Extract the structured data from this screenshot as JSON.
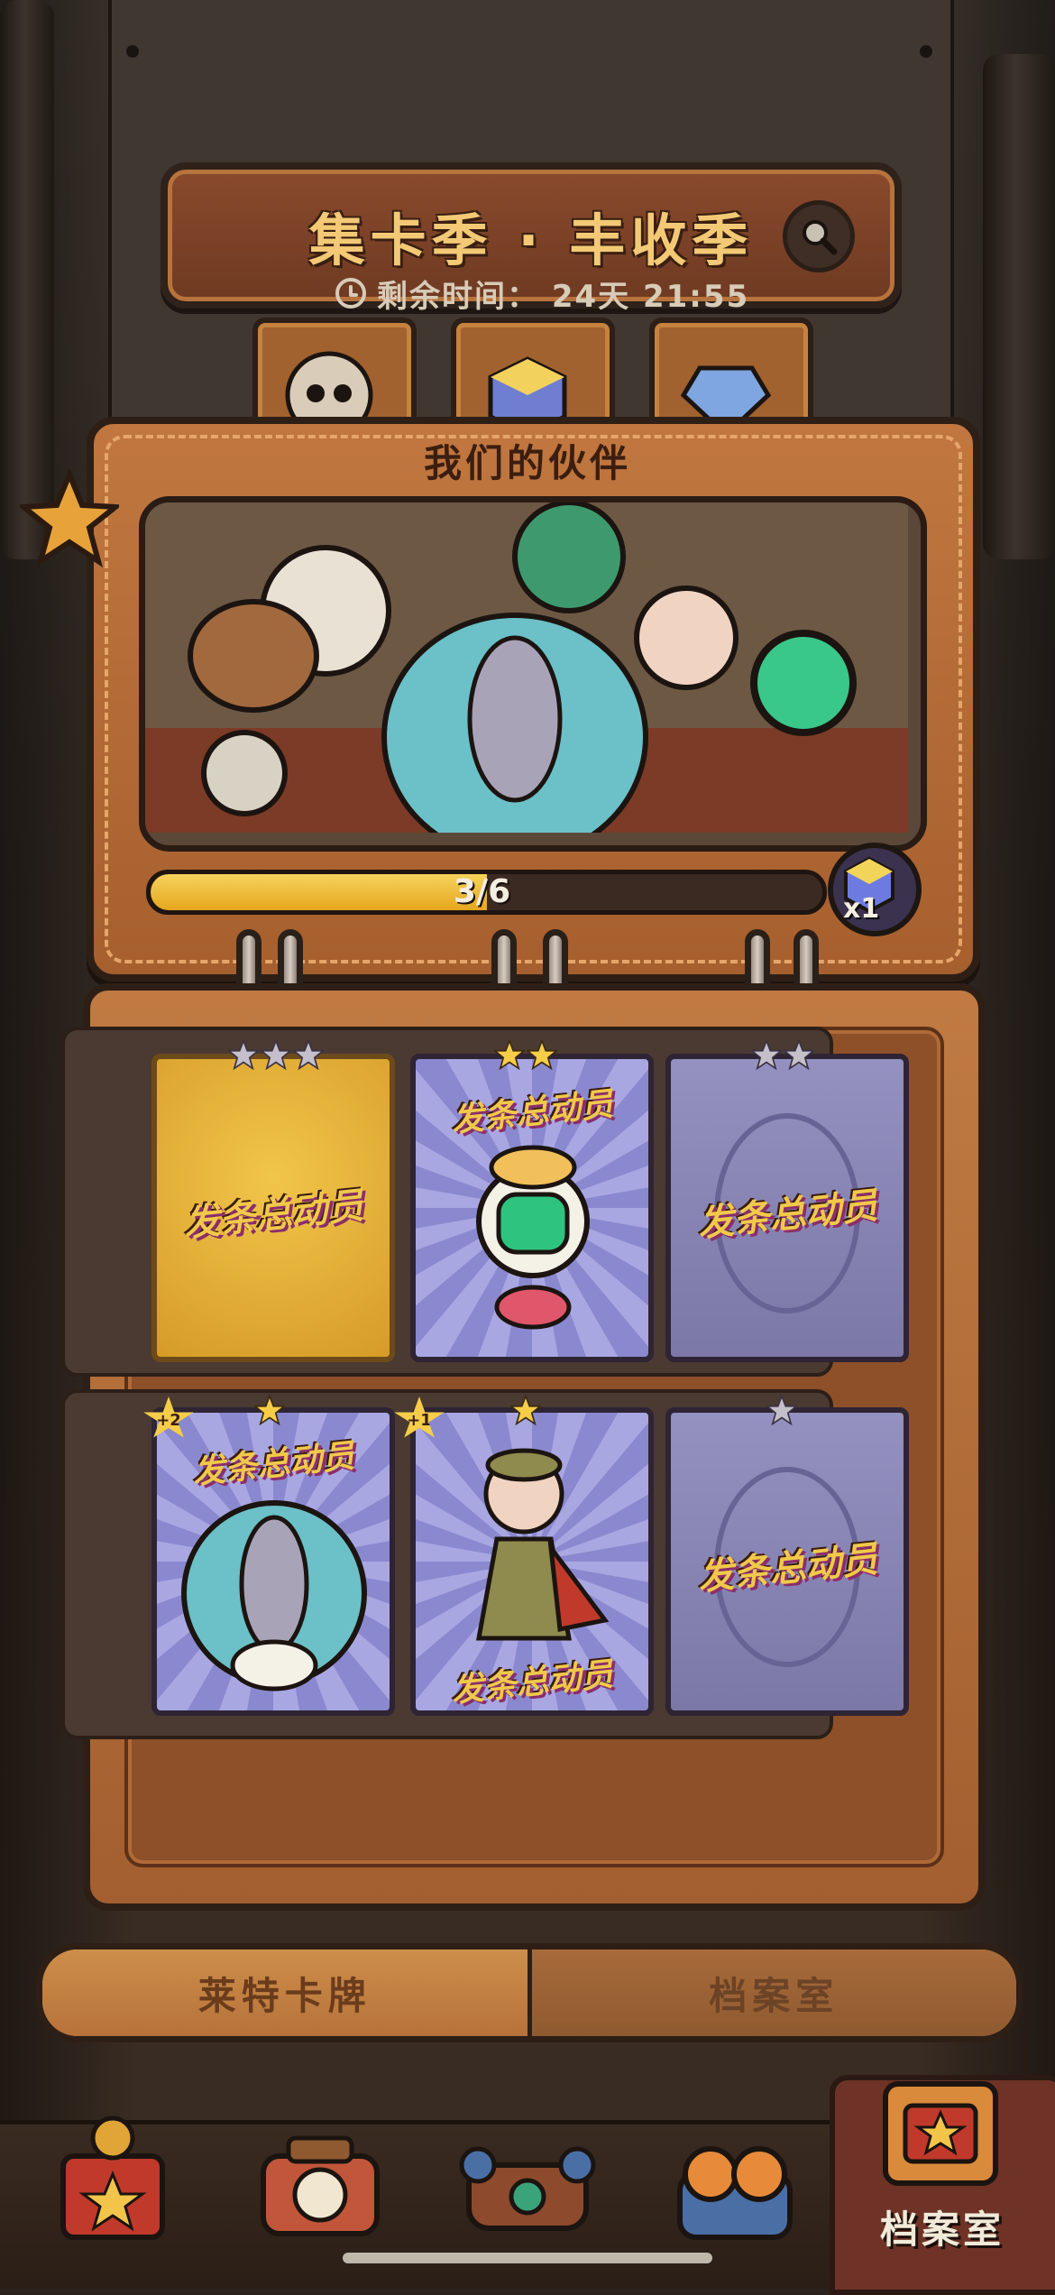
{
  "header": {
    "title": "集卡季 · 丰收季",
    "timer_label": "剩余时间：",
    "timer_value": "24天 21:55"
  },
  "album": {
    "title": "我们的伙伴",
    "progress": {
      "collected": 3,
      "total": 6,
      "label": "3/6"
    },
    "reward_count": "x1"
  },
  "cards": [
    {
      "state": "gold",
      "stars": 3,
      "logo": "发条总动员",
      "bonus": ""
    },
    {
      "state": "owned",
      "stars": 2,
      "logo": "发条总动员",
      "bonus": ""
    },
    {
      "state": "empty",
      "stars": 2,
      "logo": "发条总动员",
      "bonus": ""
    },
    {
      "state": "owned",
      "stars": 1,
      "logo": "发条总动员",
      "bonus": "+2"
    },
    {
      "state": "owned",
      "stars": 1,
      "logo": "发条总动员",
      "bonus": "+1"
    },
    {
      "state": "empty",
      "stars": 1,
      "logo": "发条总动员",
      "bonus": ""
    }
  ],
  "nav": {
    "tab_cards": "莱特卡牌",
    "tab_archive": "档案室"
  },
  "dock": {
    "items": [
      {
        "name": "chest-icon"
      },
      {
        "name": "camera-icon"
      },
      {
        "name": "radio-icon"
      },
      {
        "name": "goggles-icon"
      },
      {
        "name": "archive-icon",
        "label": "档案室",
        "active": true
      }
    ]
  },
  "colors": {
    "gold": "#f0c94a",
    "leather": "#b46a35",
    "card_purple": "#9491c0",
    "progress": "#f1c544"
  }
}
